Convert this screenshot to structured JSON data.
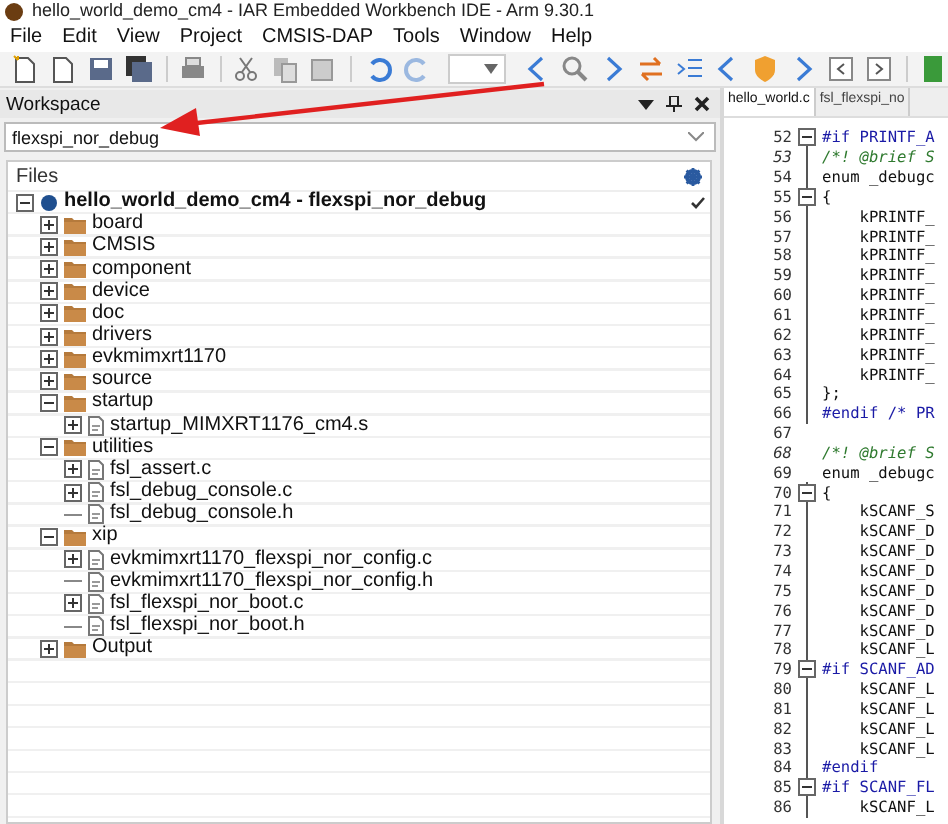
{
  "window": {
    "title": "hello_world_demo_cm4 - IAR Embedded Workbench IDE - Arm 9.30.1"
  },
  "menu": [
    "File",
    "Edit",
    "View",
    "Project",
    "CMSIS-DAP",
    "Tools",
    "Window",
    "Help"
  ],
  "workspace": {
    "title": "Workspace",
    "configuration": "flexspi_nor_debug",
    "files_header": "Files",
    "tree": [
      {
        "label": "hello_world_demo_cm4 - flexspi_nor_debug",
        "kind": "project",
        "expanded": true,
        "checked": true,
        "children": [
          {
            "label": "board",
            "kind": "folder",
            "expanded": false
          },
          {
            "label": "CMSIS",
            "kind": "folder",
            "expanded": false
          },
          {
            "label": "component",
            "kind": "folder",
            "expanded": false
          },
          {
            "label": "device",
            "kind": "folder",
            "expanded": false
          },
          {
            "label": "doc",
            "kind": "folder",
            "expanded": false
          },
          {
            "label": "drivers",
            "kind": "folder",
            "expanded": false
          },
          {
            "label": "evkmimxrt1170",
            "kind": "folder",
            "expanded": false
          },
          {
            "label": "source",
            "kind": "folder",
            "expanded": false
          },
          {
            "label": "startup",
            "kind": "folder",
            "expanded": true,
            "children": [
              {
                "label": "startup_MIMXRT1176_cm4.s",
                "kind": "file",
                "expanded": false
              }
            ]
          },
          {
            "label": "utilities",
            "kind": "folder",
            "expanded": true,
            "children": [
              {
                "label": "fsl_assert.c",
                "kind": "file",
                "expanded": false
              },
              {
                "label": "fsl_debug_console.c",
                "kind": "file",
                "expanded": false
              },
              {
                "label": "fsl_debug_console.h",
                "kind": "file"
              }
            ]
          },
          {
            "label": "xip",
            "kind": "folder",
            "expanded": true,
            "children": [
              {
                "label": "evkmimxrt1170_flexspi_nor_config.c",
                "kind": "file",
                "expanded": false
              },
              {
                "label": "evkmimxrt1170_flexspi_nor_config.h",
                "kind": "file"
              },
              {
                "label": "fsl_flexspi_nor_boot.c",
                "kind": "file",
                "expanded": false
              },
              {
                "label": "fsl_flexspi_nor_boot.h",
                "kind": "file"
              }
            ]
          },
          {
            "label": "Output",
            "kind": "folder",
            "expanded": false
          }
        ]
      }
    ]
  },
  "editor": {
    "tabs": [
      {
        "label": "hello_world.c",
        "selected": true
      },
      {
        "label": "fsl_flexspi_no",
        "selected": false
      }
    ],
    "lines": [
      {
        "number": "52",
        "text": "#if PRINTF_A",
        "kind": "directive",
        "fold_toggle": true
      },
      {
        "number": "53",
        "text": "/*! @brief S",
        "kind": "comment",
        "fold_line": true
      },
      {
        "number": "54",
        "text": "enum _debugc",
        "kind": "code",
        "fold_line": true
      },
      {
        "number": "55",
        "text": "{",
        "kind": "code",
        "fold_toggle": true
      },
      {
        "number": "56",
        "text": "    kPRINTF_",
        "kind": "code",
        "fold_line": true
      },
      {
        "number": "57",
        "text": "    kPRINTF_",
        "kind": "code",
        "fold_line": true
      },
      {
        "number": "58",
        "text": "    kPRINTF_",
        "kind": "code",
        "fold_line": true
      },
      {
        "number": "59",
        "text": "    kPRINTF_",
        "kind": "code",
        "fold_line": true
      },
      {
        "number": "60",
        "text": "    kPRINTF_",
        "kind": "code",
        "fold_line": true
      },
      {
        "number": "61",
        "text": "    kPRINTF_",
        "kind": "code",
        "fold_line": true
      },
      {
        "number": "62",
        "text": "    kPRINTF_",
        "kind": "code",
        "fold_line": true
      },
      {
        "number": "63",
        "text": "    kPRINTF_",
        "kind": "code",
        "fold_line": true
      },
      {
        "number": "64",
        "text": "    kPRINTF_",
        "kind": "code",
        "fold_line": true
      },
      {
        "number": "65",
        "text": "};",
        "kind": "code",
        "fold_line": true
      },
      {
        "number": "66",
        "text": "#endif /* PR",
        "kind": "directive",
        "fold_line": true
      },
      {
        "number": "67"
      },
      {
        "number": "68",
        "text": "/*! @brief S",
        "kind": "comment"
      },
      {
        "number": "69",
        "text": "enum _debugc",
        "kind": "code"
      },
      {
        "number": "70",
        "text": "{",
        "kind": "code",
        "fold_toggle": true
      },
      {
        "number": "71",
        "text": "    kSCANF_S",
        "kind": "code",
        "fold_line": true
      },
      {
        "number": "72",
        "text": "    kSCANF_D",
        "kind": "code",
        "fold_line": true
      },
      {
        "number": "73",
        "text": "    kSCANF_D",
        "kind": "code",
        "fold_line": true
      },
      {
        "number": "74",
        "text": "    kSCANF_D",
        "kind": "code",
        "fold_line": true
      },
      {
        "number": "75",
        "text": "    kSCANF_D",
        "kind": "code",
        "fold_line": true
      },
      {
        "number": "76",
        "text": "    kSCANF_D",
        "kind": "code",
        "fold_line": true
      },
      {
        "number": "77",
        "text": "    kSCANF_D",
        "kind": "code",
        "fold_line": true
      },
      {
        "number": "78",
        "text": "    kSCANF_L",
        "kind": "code",
        "fold_line": true
      },
      {
        "number": "79",
        "text": "#if SCANF_AD",
        "kind": "directive",
        "fold_toggle": true
      },
      {
        "number": "80",
        "text": "    kSCANF_L",
        "kind": "code",
        "fold_line": true
      },
      {
        "number": "81",
        "text": "    kSCANF_L",
        "kind": "code",
        "fold_line": true
      },
      {
        "number": "82",
        "text": "    kSCANF_L",
        "kind": "code",
        "fold_line": true
      },
      {
        "number": "83",
        "text": "    kSCANF_L",
        "kind": "code",
        "fold_line": true
      },
      {
        "number": "84",
        "text": "#endif",
        "kind": "directive",
        "fold_line": true
      },
      {
        "number": "85",
        "text": "#if SCANF_FL",
        "kind": "directive",
        "fold_toggle": true
      },
      {
        "number": "86",
        "text": "    kSCANF_L",
        "kind": "code",
        "fold_line": true
      }
    ]
  }
}
